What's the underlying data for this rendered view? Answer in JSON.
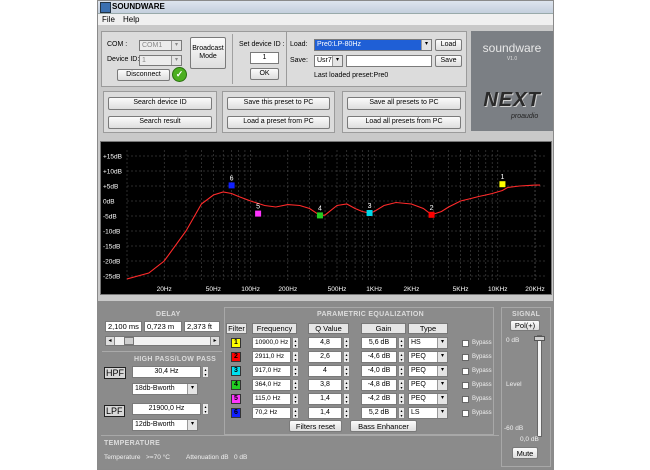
{
  "window": {
    "title": "SOUNDWARE"
  },
  "menu": {
    "file": "File",
    "help": "Help"
  },
  "connection": {
    "com_label": "COM :",
    "com_value": "COM1",
    "device_label": "Device ID:",
    "device_value": "1",
    "disconnect": "Disconnect",
    "broadcast": "Broadcast Mode",
    "set_device_label": "Set device ID :",
    "set_device_value": "1",
    "ok": "OK"
  },
  "preset": {
    "load_label": "Load:",
    "load_value": "Pre0:LP-80Hz",
    "load_btn": "Load",
    "save_label": "Save:",
    "save_value": "Usr7",
    "save_name": "",
    "save_btn": "Save",
    "last_loaded": "Last loaded preset:Pre0"
  },
  "actions": {
    "search_device": "Search device ID",
    "search_result": "Search result",
    "save_this": "Save this preset to PC",
    "load_preset": "Load a preset from PC",
    "save_all": "Save all presets to PC",
    "load_all": "Load all presets from PC"
  },
  "brand": {
    "name": "soundware",
    "version": "V1.0",
    "next": "NEXT",
    "proaudio": "proaudio"
  },
  "chart_data": {
    "type": "line",
    "y_ticks": [
      "+15dB",
      "+10dB",
      "+5dB",
      "0dB",
      "-5dB",
      "-10dB",
      "-15dB",
      "-20dB",
      "-25dB"
    ],
    "x_ticks": [
      "20Hz",
      "50Hz",
      "100Hz",
      "200Hz",
      "500Hz",
      "1KHz",
      "2KHz",
      "5KHz",
      "10KHz",
      "20KHz"
    ],
    "x_tick_values": [
      20,
      50,
      100,
      200,
      500,
      1000,
      2000,
      5000,
      10000,
      20000
    ],
    "xlim": [
      10,
      25000
    ],
    "ylim": [
      -27,
      17
    ],
    "series": [
      {
        "x": [
          10,
          15,
          20,
          30,
          40,
          50,
          60,
          70,
          80,
          100,
          130,
          160,
          200,
          250,
          300,
          364,
          400,
          500,
          600,
          700,
          800,
          917,
          1000,
          1200,
          1500,
          2000,
          2500,
          2911,
          3500,
          4000,
          5000,
          6000,
          7000,
          8000,
          9000,
          10900,
          12000,
          15000,
          18000,
          20000,
          22000
        ],
        "y": [
          -26,
          -24,
          -20,
          -10,
          -1,
          2,
          3,
          2.5,
          1.5,
          0,
          -1.5,
          -2,
          -1.2,
          -1.5,
          -2.5,
          -4.8,
          -4.7,
          -1.5,
          -1.0,
          -2.5,
          -3.5,
          -4.0,
          -3.5,
          -1.5,
          -0.5,
          -1.0,
          -2.5,
          -4.6,
          -3.5,
          -2.0,
          0,
          0.8,
          1.5,
          2.0,
          2.5,
          3.5,
          4.5,
          5.0,
          5.2,
          5.3,
          5.3
        ]
      }
    ],
    "points": [
      {
        "label": "1",
        "x": 10900,
        "y": 5.6,
        "color": "#ffff00"
      },
      {
        "label": "2",
        "x": 2911,
        "y": -4.6,
        "color": "#ff0000"
      },
      {
        "label": "3",
        "x": 917,
        "y": -4.0,
        "color": "#00d8e8"
      },
      {
        "label": "4",
        "x": 364,
        "y": -4.8,
        "color": "#22cc22"
      },
      {
        "label": "5",
        "x": 115,
        "y": -4.2,
        "color": "#ff33ff"
      },
      {
        "label": "6",
        "x": 70.2,
        "y": 5.2,
        "color": "#1020ff"
      }
    ]
  },
  "delay": {
    "title": "DELAY",
    "ms": "2,100 ms",
    "m": "0,723 m",
    "ft": "2,373 ft",
    "position": 0.12
  },
  "hplp": {
    "title": "HIGH PASS/LOW PASS",
    "hpf_label": "HPF",
    "hpf_freq": "30,4 Hz",
    "hpf_type": "18db-Bworth",
    "lpf_label": "LPF",
    "lpf_freq": "21900,0 Hz",
    "lpf_type": "12db-Bworth"
  },
  "peq": {
    "title": "PARAMETRIC EQUALIZATION",
    "headers": {
      "filter": "Filter",
      "frequency": "Frequency",
      "q": "Q Value",
      "gain": "Gain",
      "type": "Type"
    },
    "bypass": "Bypass",
    "rows": [
      {
        "n": "1",
        "freq": "10900,0 Hz",
        "q": "4,8",
        "gain": "5,6 dB",
        "type": "HS",
        "color": "#ffff00"
      },
      {
        "n": "2",
        "freq": "2911,0 Hz",
        "q": "2,6",
        "gain": "-4,6 dB",
        "type": "PEQ",
        "color": "#ff0000"
      },
      {
        "n": "3",
        "freq": "917,0 Hz",
        "q": "4",
        "gain": "-4,0 dB",
        "type": "PEQ",
        "color": "#00e0f0"
      },
      {
        "n": "4",
        "freq": "364,0 Hz",
        "q": "3,8",
        "gain": "-4,8 dB",
        "type": "PEQ",
        "color": "#22cc22"
      },
      {
        "n": "5",
        "freq": "115,0 Hz",
        "q": "1,4",
        "gain": "-4,2 dB",
        "type": "PEQ",
        "color": "#ff33ff"
      },
      {
        "n": "6",
        "freq": "70,2 Hz",
        "q": "1,4",
        "gain": "5,2 dB",
        "type": "LS",
        "color": "#1020ff"
      }
    ],
    "filters_reset": "Filters reset",
    "bass_enhancer": "Bass Enhancer"
  },
  "signal": {
    "title": "SIGNAL",
    "pol": "Pol(+)",
    "top": "0 dB",
    "level": "Level",
    "bottom": "-60 dB",
    "value": "0,0 dB",
    "mute": "Mute"
  },
  "temperature": {
    "title": "TEMPERATURE",
    "temp_label": "Temperature",
    "temp_value": ">=70 °C",
    "atten_label": "Attenuation dB",
    "atten_value": "0 dB"
  }
}
